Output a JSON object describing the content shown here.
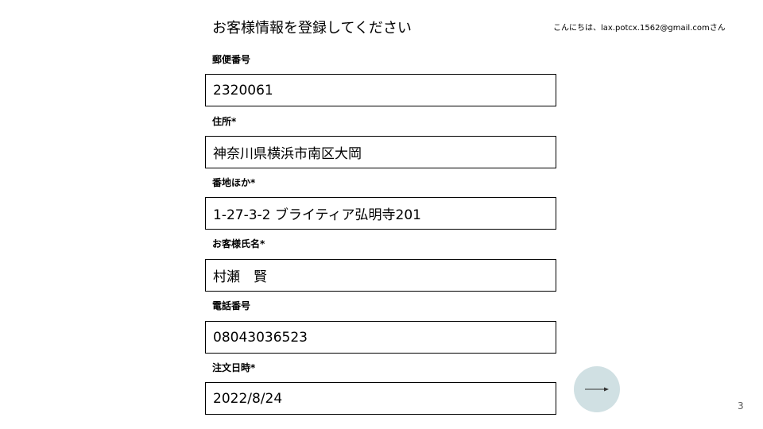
{
  "header": {
    "title": "お客様情報を登録してください",
    "greeting": "こんにちは、lax.potcx.1562@gmail.comさん"
  },
  "form": {
    "fields": [
      {
        "label": "郵便番号",
        "value": "2320061"
      },
      {
        "label": "住所*",
        "value": "神奈川県横浜市南区大岡"
      },
      {
        "label": "番地ほか*",
        "value": "1-27-3-2 ブライティア弘明寺201"
      },
      {
        "label": "お客様氏名*",
        "value": "村瀬　賢"
      },
      {
        "label": "電話番号",
        "value": "08043036523"
      },
      {
        "label": "注文日時*",
        "value": "2022/8/24"
      }
    ]
  },
  "next_button": {
    "icon": "arrow-right-icon",
    "color": "#d0e0e3"
  },
  "footer": {
    "slide_number": "3"
  }
}
